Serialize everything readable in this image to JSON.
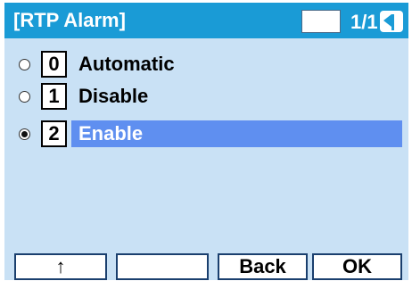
{
  "header": {
    "title": "[RTP Alarm]",
    "page": "1/1",
    "nav_icon": "up-arrow-icon"
  },
  "options": [
    {
      "number": "0",
      "label": "Automatic",
      "selected": false
    },
    {
      "number": "1",
      "label": "Disable",
      "selected": false
    },
    {
      "number": "2",
      "label": "Enable",
      "selected": true
    }
  ],
  "softkeys": [
    {
      "label": "↑"
    },
    {
      "label": ""
    },
    {
      "label": "Back"
    },
    {
      "label": "OK"
    }
  ],
  "colors": {
    "header_bg": "#1a9bd6",
    "screen_bg": "#c9e1f5",
    "highlight": "#5f8ff0"
  }
}
